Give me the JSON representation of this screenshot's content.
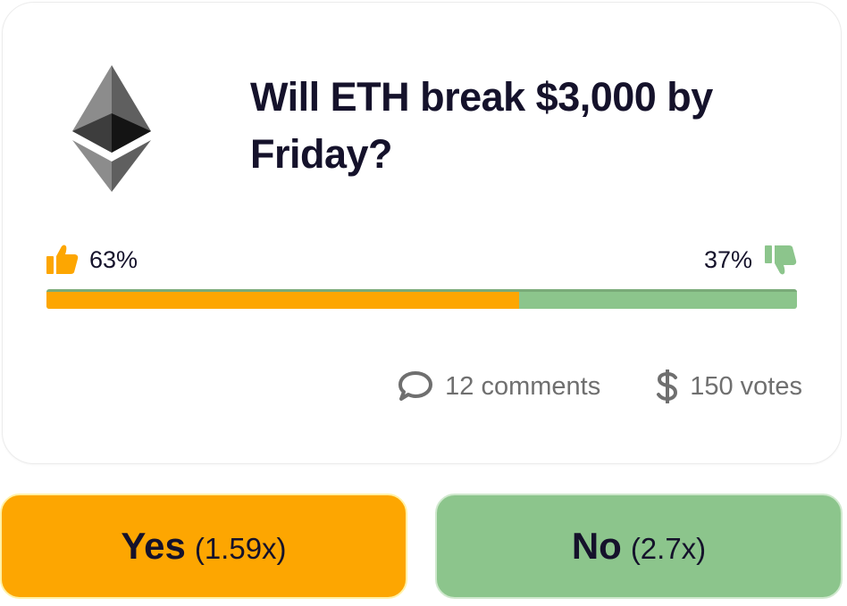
{
  "poll": {
    "title": "Will ETH break $3,000 by Friday?",
    "yes_percent_label": "63%",
    "no_percent_label": "37%",
    "yes_fraction": 0.63,
    "comments_label": "12 comments",
    "votes_label": "150 votes"
  },
  "buttons": {
    "yes_label": "Yes",
    "yes_odds": "(1.59x)",
    "no_label": "No",
    "no_odds": "(2.7x)"
  },
  "icons": {
    "logo": "ethereum-icon",
    "yes": "thumbs-up-icon",
    "no": "thumbs-down-icon",
    "comments": "chat-bubble-icon",
    "votes": "dollar-icon"
  },
  "colors": {
    "yes": "#fda601",
    "no": "#8cc58c",
    "text": "#15122b",
    "muted": "#6f6f6f"
  }
}
